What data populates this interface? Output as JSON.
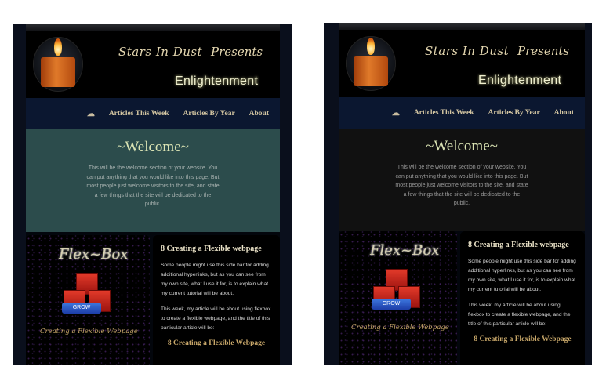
{
  "site": {
    "logo_line1": "Stars In Dust",
    "logo_line2": "Presents",
    "subtitle": "Enlightenment"
  },
  "nav": {
    "home_icon": "cloud-home-icon",
    "items": [
      "Articles This Week",
      "Articles By Year",
      "About"
    ]
  },
  "welcome": {
    "title": "~Welcome~",
    "text": "This will be the welcome section of your website. You can put anything that you would like into this page. But most people just welcome visitors to the site, and state a few things that the site will be dedicated to the public."
  },
  "aside": {
    "logo": "Flex~Box",
    "button": "GROW",
    "caption": "Creating a Flexible Webpage"
  },
  "article": {
    "heading": "8 Creating a Flexible webpage",
    "para1": "Some people might use this side bar for adding additional hyperlinks, but as you can see from my own site, what I use it for, is to explain what my current tutorial will be about.",
    "para2": "This week, my article will be about using flexbox to create a flexible webpage, and the title of this particular article will be:",
    "link": "8 Creating a Flexible Webpage"
  },
  "colors": {
    "left_welcome_bg": "#2c4c4c",
    "right_welcome_bg": "#111111",
    "nav_bg": "#0b1730"
  }
}
